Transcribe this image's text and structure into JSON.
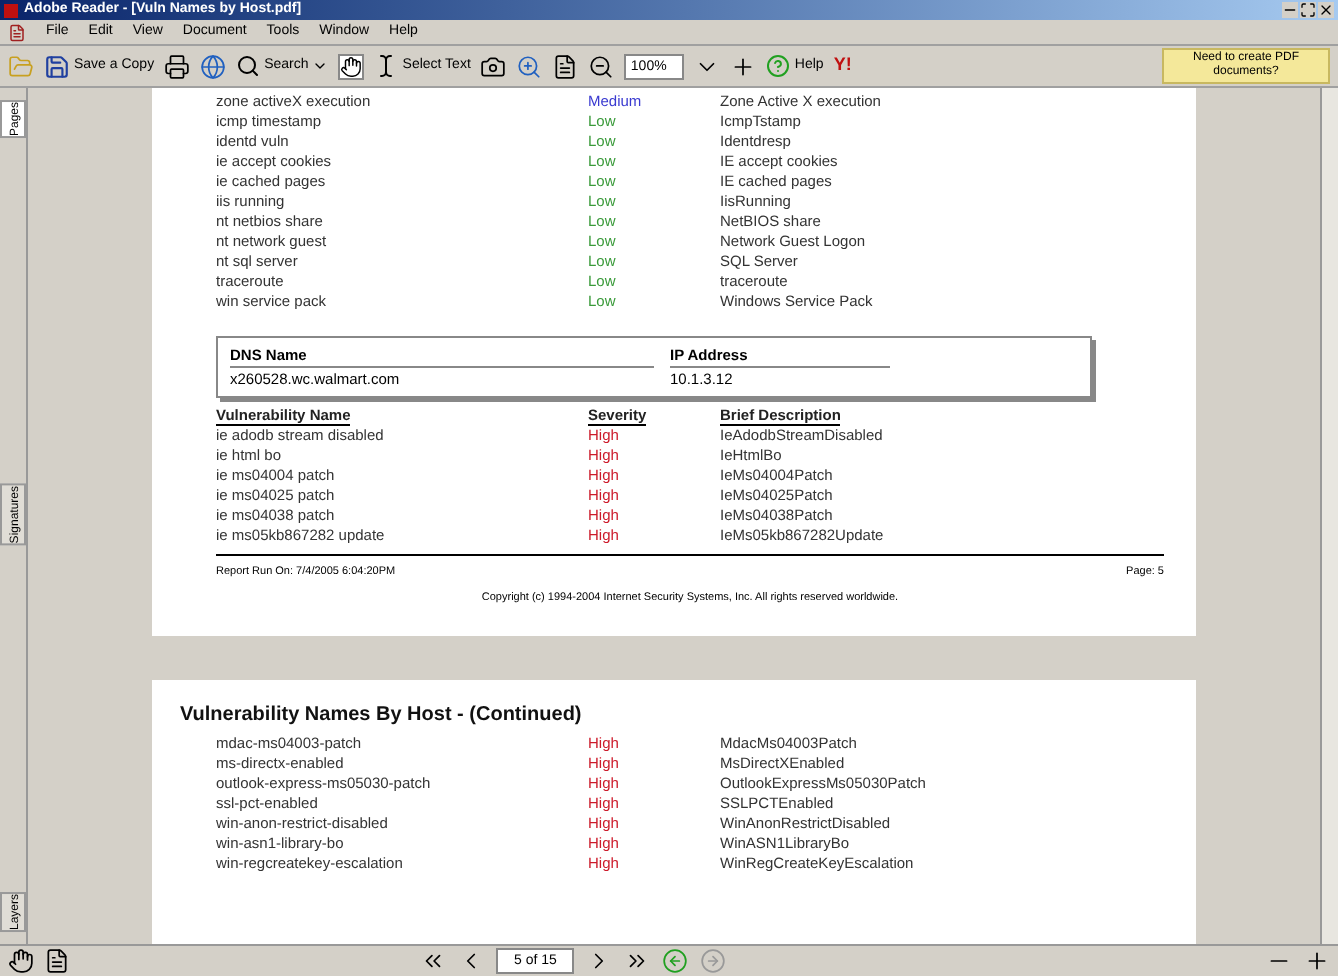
{
  "window": {
    "title": "Adobe Reader - [Vuln Names by Host.pdf]"
  },
  "menu": [
    "File",
    "Edit",
    "View",
    "Document",
    "Tools",
    "Window",
    "Help"
  ],
  "toolbar": {
    "save": "Save a Copy",
    "search": "Search",
    "select": "Select Text",
    "zoom": "100%",
    "help": "Help",
    "yahoo": "Y!",
    "promo": "Need to create PDF documents?"
  },
  "side_tabs": [
    {
      "label": "Pages",
      "selected": true
    },
    {
      "label": "Signatures",
      "selected": false
    },
    {
      "label": "Layers",
      "selected": false
    }
  ],
  "page1": {
    "rows": [
      {
        "name": "zone activeX execution",
        "severity": "Medium",
        "color": "#3a3ad0",
        "description": "Zone Active X execution"
      },
      {
        "name": "icmp timestamp",
        "severity": "Low",
        "color": "#3a9a3a",
        "description": "IcmpTstamp"
      },
      {
        "name": "identd vuln",
        "severity": "Low",
        "color": "#3a9a3a",
        "description": "Identdresp"
      },
      {
        "name": "ie accept cookies",
        "severity": "Low",
        "color": "#3a9a3a",
        "description": "IE accept cookies"
      },
      {
        "name": "ie cached pages",
        "severity": "Low",
        "color": "#3a9a3a",
        "description": "IE cached pages"
      },
      {
        "name": "iis running",
        "severity": "Low",
        "color": "#3a9a3a",
        "description": "IisRunning"
      },
      {
        "name": "nt netbios share",
        "severity": "Low",
        "color": "#3a9a3a",
        "description": "NetBIOS share"
      },
      {
        "name": "nt network guest",
        "severity": "Low",
        "color": "#3a9a3a",
        "description": "Network Guest Logon"
      },
      {
        "name": "nt sql server",
        "severity": "Low",
        "color": "#3a9a3a",
        "description": "SQL Server"
      },
      {
        "name": "traceroute",
        "severity": "Low",
        "color": "#3a9a3a",
        "description": "traceroute"
      },
      {
        "name": "win service pack",
        "severity": "Low",
        "color": "#3a9a3a",
        "description": "Windows Service Pack"
      }
    ],
    "host": {
      "dns_label": "DNS Name",
      "ip_label": "IP Address",
      "dns": "x260528.wc.walmart.com",
      "ip": "10.1.3.12"
    },
    "columns": [
      "Vulnerability Name",
      "Severity",
      "Brief Description"
    ],
    "vulns": [
      {
        "name": "ie adodb stream disabled",
        "severity": "High",
        "color": "#cc1a2a",
        "description": "IeAdodbStreamDisabled"
      },
      {
        "name": "ie html bo",
        "severity": "High",
        "color": "#cc1a2a",
        "description": "IeHtmlBo"
      },
      {
        "name": "ie ms04004 patch",
        "severity": "High",
        "color": "#cc1a2a",
        "description": "IeMs04004Patch"
      },
      {
        "name": "ie ms04025 patch",
        "severity": "High",
        "color": "#cc1a2a",
        "description": "IeMs04025Patch"
      },
      {
        "name": "ie ms04038 patch",
        "severity": "High",
        "color": "#cc1a2a",
        "description": "IeMs04038Patch"
      },
      {
        "name": "ie ms05kb867282 update",
        "severity": "High",
        "color": "#cc1a2a",
        "description": "IeMs05kb867282Update"
      }
    ],
    "footer_left": "Report Run On: 7/4/2005 6:04:20PM",
    "footer_right": "Page: 5",
    "copyright": "Copyright (c) 1994-2004 Internet Security Systems, Inc. All rights reserved worldwide."
  },
  "page2": {
    "heading": "Vulnerability Names By Host - (Continued)",
    "rows": [
      {
        "name": "mdac-ms04003-patch",
        "severity": "High",
        "color": "#cc1a2a",
        "description": "MdacMs04003Patch"
      },
      {
        "name": "ms-directx-enabled",
        "severity": "High",
        "color": "#cc1a2a",
        "description": "MsDirectXEnabled"
      },
      {
        "name": "outlook-express-ms05030-patch",
        "severity": "High",
        "color": "#cc1a2a",
        "description": "OutlookExpressMs05030Patch"
      },
      {
        "name": "ssl-pct-enabled",
        "severity": "High",
        "color": "#cc1a2a",
        "description": "SSLPCTEnabled"
      },
      {
        "name": "win-anon-restrict-disabled",
        "severity": "High",
        "color": "#cc1a2a",
        "description": "WinAnonRestrictDisabled"
      },
      {
        "name": "win-asn1-library-bo",
        "severity": "High",
        "color": "#cc1a2a",
        "description": "WinASN1LibraryBo"
      },
      {
        "name": "win-regcreatekey-escalation",
        "severity": "High",
        "color": "#cc1a2a",
        "description": "WinRegCreateKeyEscalation"
      }
    ]
  },
  "status": {
    "page": "5 of 15"
  }
}
